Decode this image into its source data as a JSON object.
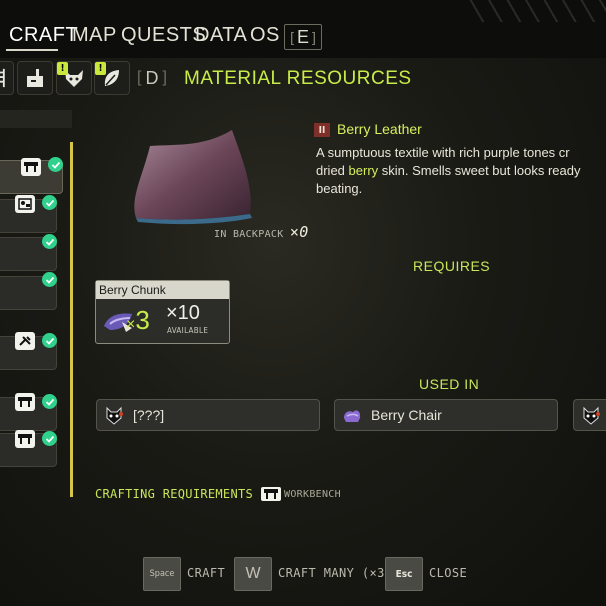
{
  "nav": {
    "tabs": [
      {
        "label": "CRAFT",
        "active": true
      },
      {
        "label": "MAP"
      },
      {
        "label": "QUESTS"
      },
      {
        "label": "DATA"
      },
      {
        "label": "OS"
      }
    ],
    "next_key": "E"
  },
  "category": {
    "prev_key": "D",
    "title": "MATERIAL RESOURCES",
    "icons": [
      "ladder-icon",
      "tool-bench-icon",
      "wolf-head-icon",
      "leaf-icon"
    ],
    "alert_mark": "!"
  },
  "item_list": {
    "icons": [
      "workbench-icon",
      "machine-icon",
      "none",
      "none",
      "hand-tool-icon",
      "workbench-icon",
      "workbench-icon"
    ]
  },
  "detail": {
    "tier": "II",
    "name": "Berry Leather",
    "description_lines": [
      "A sumptuous textile with rich purple tones cr",
      "dried ",
      "berry",
      " skin. Smells sweet but looks ready",
      "beating."
    ],
    "backpack_label": "IN BACKPACK",
    "backpack_count": "×0"
  },
  "requires": {
    "heading": "REQUIRES",
    "items": [
      {
        "name": "Berry Chunk",
        "qty": "3",
        "qty_prefix": "×",
        "have": "×10",
        "available_label": "AVAILABLE"
      }
    ]
  },
  "used_in": {
    "heading": "USED IN",
    "items": [
      {
        "label": "[???]",
        "icon": "unknown-creature-icon"
      },
      {
        "label": "Berry Chair",
        "icon": "berry-chair-icon"
      },
      {
        "label": "",
        "icon": "unknown-creature-icon"
      }
    ]
  },
  "crafting_requirements": {
    "label": "CRAFTING REQUIREMENTS",
    "station": "WORKBENCH"
  },
  "controls": [
    {
      "key": "Space",
      "label": "CRAFT"
    },
    {
      "key": "W",
      "label": "CRAFT MANY (×3)"
    },
    {
      "key": "Esc",
      "label": "CLOSE"
    }
  ],
  "colors": {
    "accent": "#c8ec48",
    "check": "#2fd18c",
    "tier_badge": "#7e2f2a",
    "scroll_line": "#d5c64b"
  }
}
